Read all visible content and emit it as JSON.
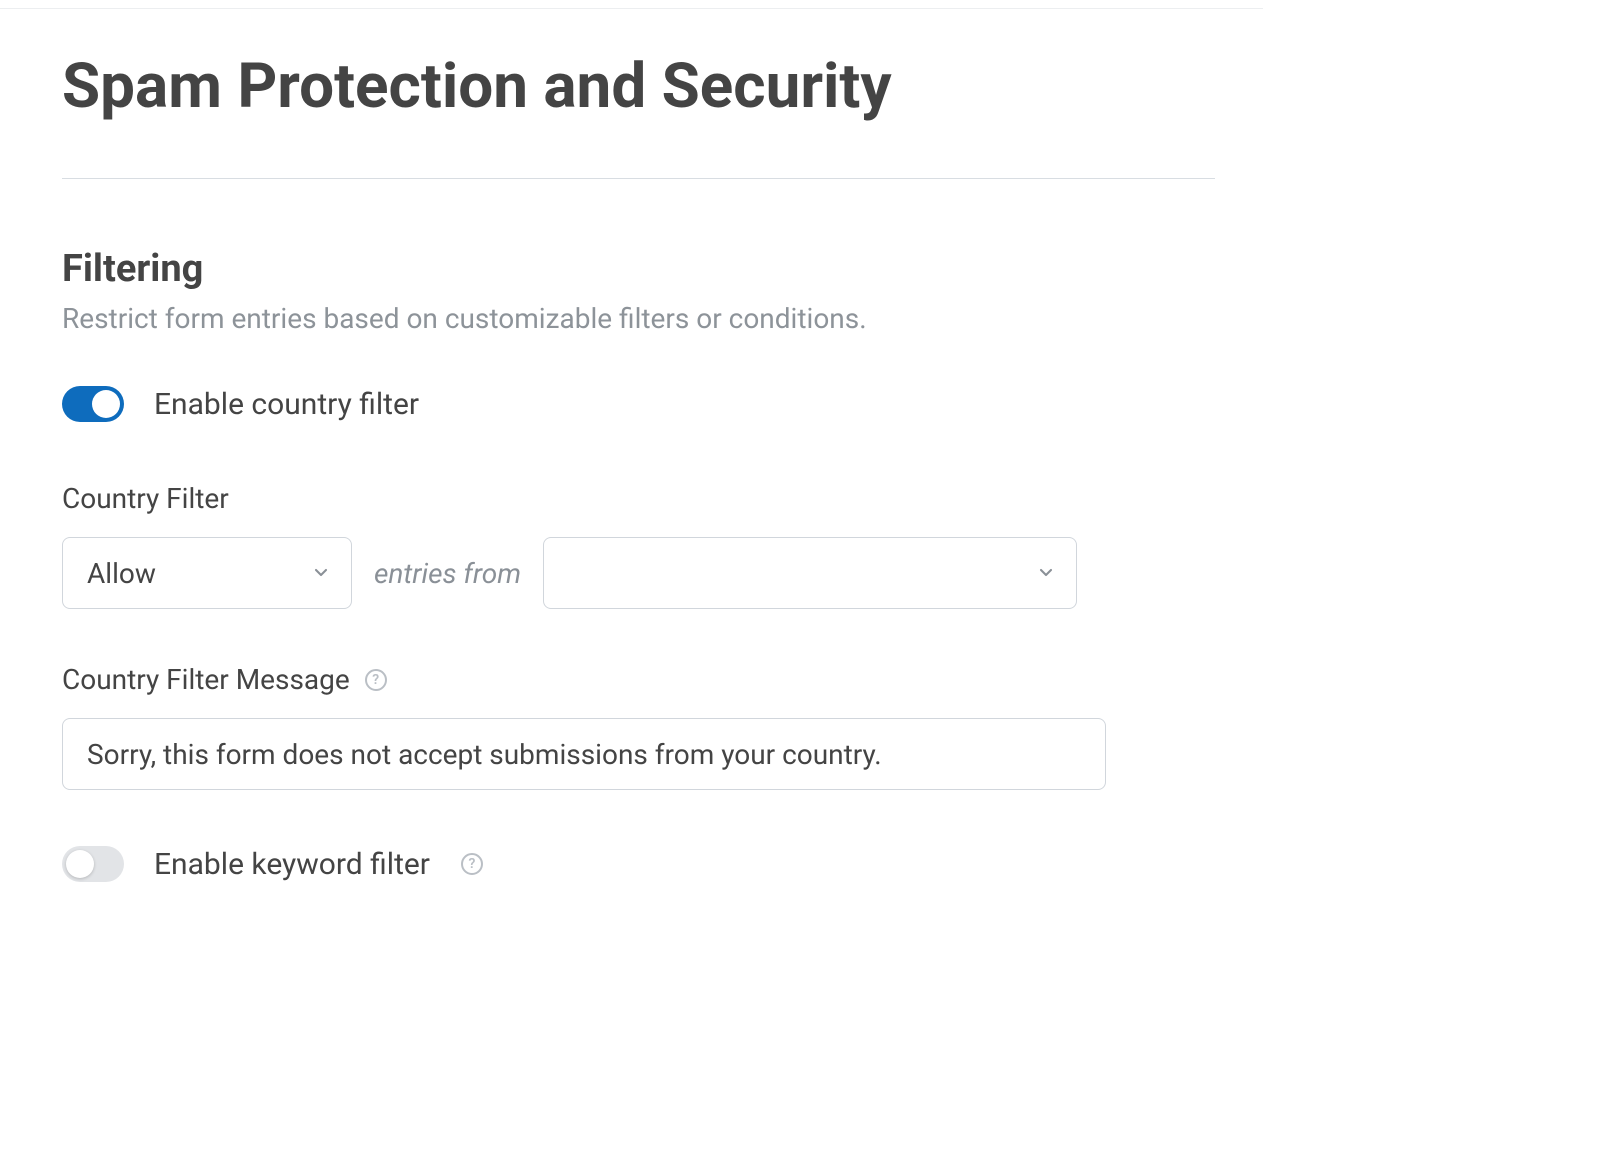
{
  "page": {
    "title": "Spam Protection and Security"
  },
  "filtering": {
    "section_title": "Filtering",
    "section_desc": "Restrict form entries based on customizable filters or conditions.",
    "country_filter": {
      "toggle_label": "Enable country filter",
      "enabled": true,
      "field_label": "Country Filter",
      "action_value": "Allow",
      "interstitial": "entries from",
      "countries_value": "",
      "message_label": "Country Filter Message",
      "message_value": "Sorry, this form does not accept submissions from your country."
    },
    "keyword_filter": {
      "toggle_label": "Enable keyword filter",
      "enabled": false
    }
  }
}
